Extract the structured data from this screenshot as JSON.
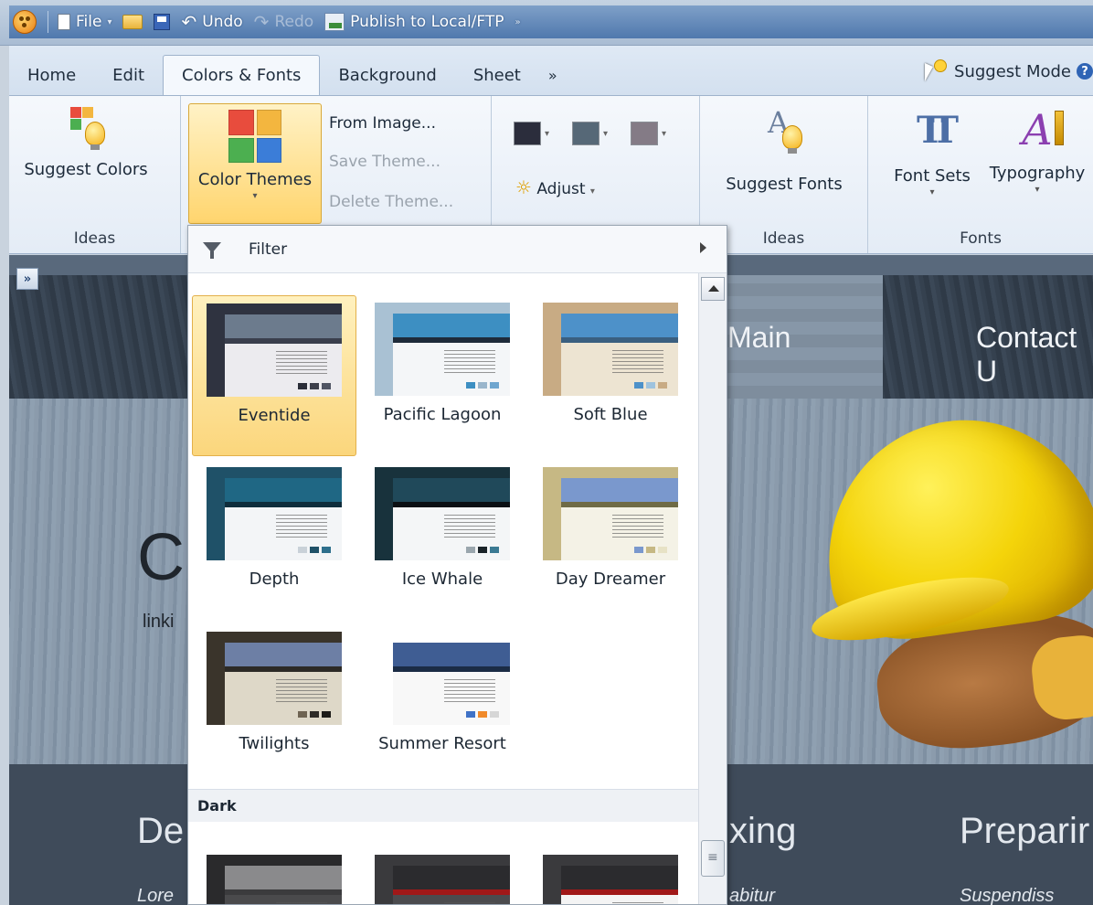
{
  "qat": {
    "file": "File",
    "undo": "Undo",
    "redo": "Redo",
    "publish": "Publish to Local/FTP"
  },
  "tabs": [
    "Home",
    "Edit",
    "Colors & Fonts",
    "Background",
    "Sheet"
  ],
  "tab_more": "»",
  "suggest_mode": "Suggest Mode",
  "ribbon": {
    "suggest_colors": "Suggest Colors",
    "color_themes": "Color Themes",
    "from_image": "From Image...",
    "save_theme": "Save Theme...",
    "delete_theme": "Delete Theme...",
    "adjust": "Adjust",
    "suggest_fonts": "Suggest Fonts",
    "font_sets": "Font Sets",
    "typography": "Typography",
    "group_ideas_1": "Ideas",
    "group_ideas_2": "Ideas",
    "group_fonts": "Fonts",
    "swatches": [
      "#2b2d3c",
      "#566877",
      "#847b86"
    ]
  },
  "gallery": {
    "filter": "Filter",
    "section_dark": "Dark",
    "themes": [
      {
        "name": "Eventide",
        "bg": "#2f3340",
        "bar": "#6c7b8d",
        "nav": "#3a3f4d",
        "content": "#ecebef",
        "sw": [
          "#2a2d38",
          "#3c3f4b",
          "#4f5463"
        ]
      },
      {
        "name": "Pacific Lagoon",
        "bg": "#a9c1d3",
        "bar": "#3d8fc2",
        "nav": "#1e2b3a",
        "content": "#f4f6f8",
        "sw": [
          "#3d8fc2",
          "#9ab6cc",
          "#6fa6cf"
        ]
      },
      {
        "name": "Soft Blue",
        "bg": "#c8ab84",
        "bar": "#4d91c9",
        "nav": "#3a5f80",
        "content": "#ede4d2",
        "sw": [
          "#4d91c9",
          "#9fc3de",
          "#c8ab84"
        ]
      },
      {
        "name": "Depth",
        "bg": "#1f5168",
        "bar": "#1f6784",
        "nav": "#0f2d3c",
        "content": "#f3f5f7",
        "sw": [
          "#c9d1d8",
          "#1f5168",
          "#2d6f8c"
        ]
      },
      {
        "name": "Ice Whale",
        "bg": "#18323c",
        "bar": "#20495a",
        "nav": "#0b1014",
        "content": "#f4f6f7",
        "sw": [
          "#9aa6ad",
          "#1a2328",
          "#3b7a93"
        ]
      },
      {
        "name": "Day Dreamer",
        "bg": "#c6b884",
        "bar": "#7a98cd",
        "nav": "#6f6b45",
        "content": "#f4f2e6",
        "sw": [
          "#7a98cd",
          "#c6b884",
          "#e7e2c5"
        ]
      },
      {
        "name": "Twilights",
        "bg": "#3a342b",
        "bar": "#6d7fa5",
        "nav": "#2c2a26",
        "content": "#ded8c8",
        "sw": [
          "#6f6452",
          "#2f2c27",
          "#1d1b18"
        ]
      },
      {
        "name": "Summer Resort",
        "bg": "#ffffff",
        "bar": "#3f5d93",
        "nav": "#1b2c45",
        "content": "#f8f8f8",
        "sw": [
          "#3f72c6",
          "#f08a2a",
          "#d6d6d6"
        ]
      },
      {
        "name": "",
        "bg": "#2a2a2c",
        "bar": "#8a8a8c",
        "nav": "#3b3b3d",
        "content": "#4a4a4c",
        "sw": []
      },
      {
        "name": "",
        "bg": "#3a3a3d",
        "bar": "#2b2b2e",
        "nav": "#a01818",
        "content": "#4b4b4e",
        "sw": []
      },
      {
        "name": "",
        "bg": "#3a3a3d",
        "bar": "#2b2b2e",
        "nav": "#a01818",
        "content": "#f4f4f4",
        "sw": []
      }
    ]
  },
  "page": {
    "nav_main": "Main",
    "nav_contact": "Contact U",
    "hero_title": "C",
    "hero_sub": "linki",
    "foot_left": "De",
    "foot_left_sub": "Lore",
    "foot_mid": "xing",
    "foot_mid_sub": "abitur",
    "foot_right": "Preparir",
    "foot_right_sub": "Suspendiss",
    "expand": "»"
  }
}
